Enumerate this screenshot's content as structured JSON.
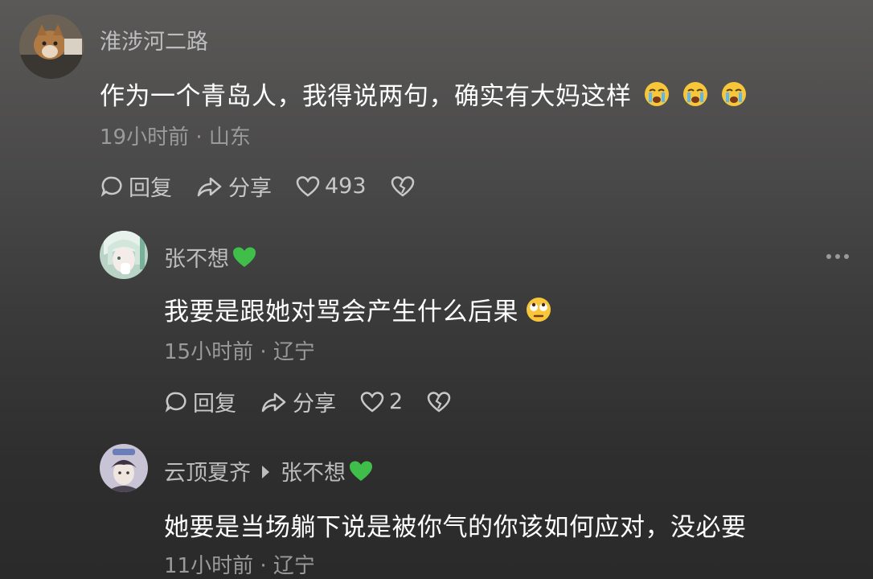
{
  "comments": [
    {
      "author": "淮涉河二路",
      "text": "作为一个青岛人，我得说两句，确实有大妈这样",
      "emoji": [
        "crying-face",
        "crying-face",
        "crying-face"
      ],
      "meta": "19小时前 · 山东",
      "reply_label": "回复",
      "share_label": "分享",
      "likes": "493"
    },
    {
      "author": "张不想",
      "badge": "green-heart",
      "text": "我要是跟她对骂会产生什么后果",
      "emoji": [
        "rolling-eyes-face"
      ],
      "meta": "15小时前 · 辽宁",
      "reply_label": "回复",
      "share_label": "分享",
      "likes": "2"
    },
    {
      "author": "云顶夏齐",
      "reply_to": "张不想",
      "badge": "green-heart",
      "text": "她要是当场躺下说是被你气的你该如何应对，没必要",
      "meta": "11小时前 · 辽宁"
    }
  ],
  "colors": {
    "accent_heart": "#3fbf4a",
    "text_primary": "#ffffff",
    "text_secondary": "#9a9a9a"
  }
}
